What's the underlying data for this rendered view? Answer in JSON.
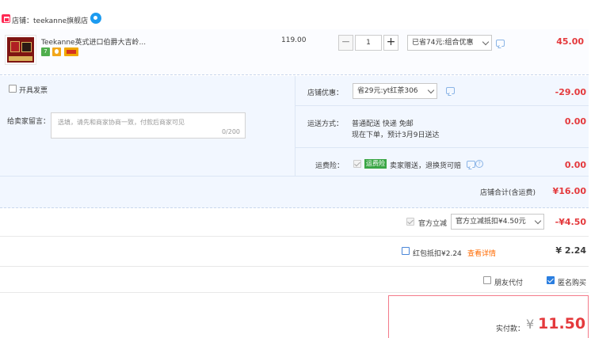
{
  "shop": {
    "name": "店铺：teekanne旗舰店"
  },
  "item": {
    "title": "Teekanne英式进口伯爵大吉岭...",
    "badge_seven": "7",
    "unit_price": "119.00",
    "quantity": "1",
    "qty_minus": "−",
    "qty_plus": "+",
    "promo_select": "已省74元:组合优惠",
    "subtotal": "45.00"
  },
  "invoice": {
    "label": "开具发票"
  },
  "message": {
    "label": "给卖家留言：",
    "placeholder": "选填，请先和商家协商一致，付款后商家可见",
    "counter": "0/200"
  },
  "shop_discount": {
    "label": "店铺优惠：",
    "select": "省29元:yt红茶306",
    "amount": "-29.00"
  },
  "delivery": {
    "label": "运送方式：",
    "method": "普通配送 快递 免邮",
    "eta": "现在下单，预计3月9日送达",
    "amount": "0.00"
  },
  "insurance": {
    "label": "运费险：",
    "tag": "运费险",
    "desc": "卖家赠送，退换货可赔",
    "amount": "0.00"
  },
  "shop_total": {
    "label": "店铺合计(含运费)",
    "amount": "¥16.00"
  },
  "official_discount": {
    "label": "官方立减",
    "select": "官方立减抵扣¥4.50元",
    "amount": "-¥4.50"
  },
  "red_packet": {
    "label": "红包抵扣¥2.24",
    "link": "查看详情",
    "amount": "¥ 2.24"
  },
  "friend_pay": {
    "label": "朋友代付"
  },
  "anonymous": {
    "label": "匿名购买"
  },
  "payment": {
    "label": "实付款：",
    "currency": "¥",
    "amount": "11.50"
  },
  "colors": {
    "accent_red": "#e4393c",
    "link_orange": "#ff6a00",
    "panel_blue": "#f2f7ff"
  }
}
